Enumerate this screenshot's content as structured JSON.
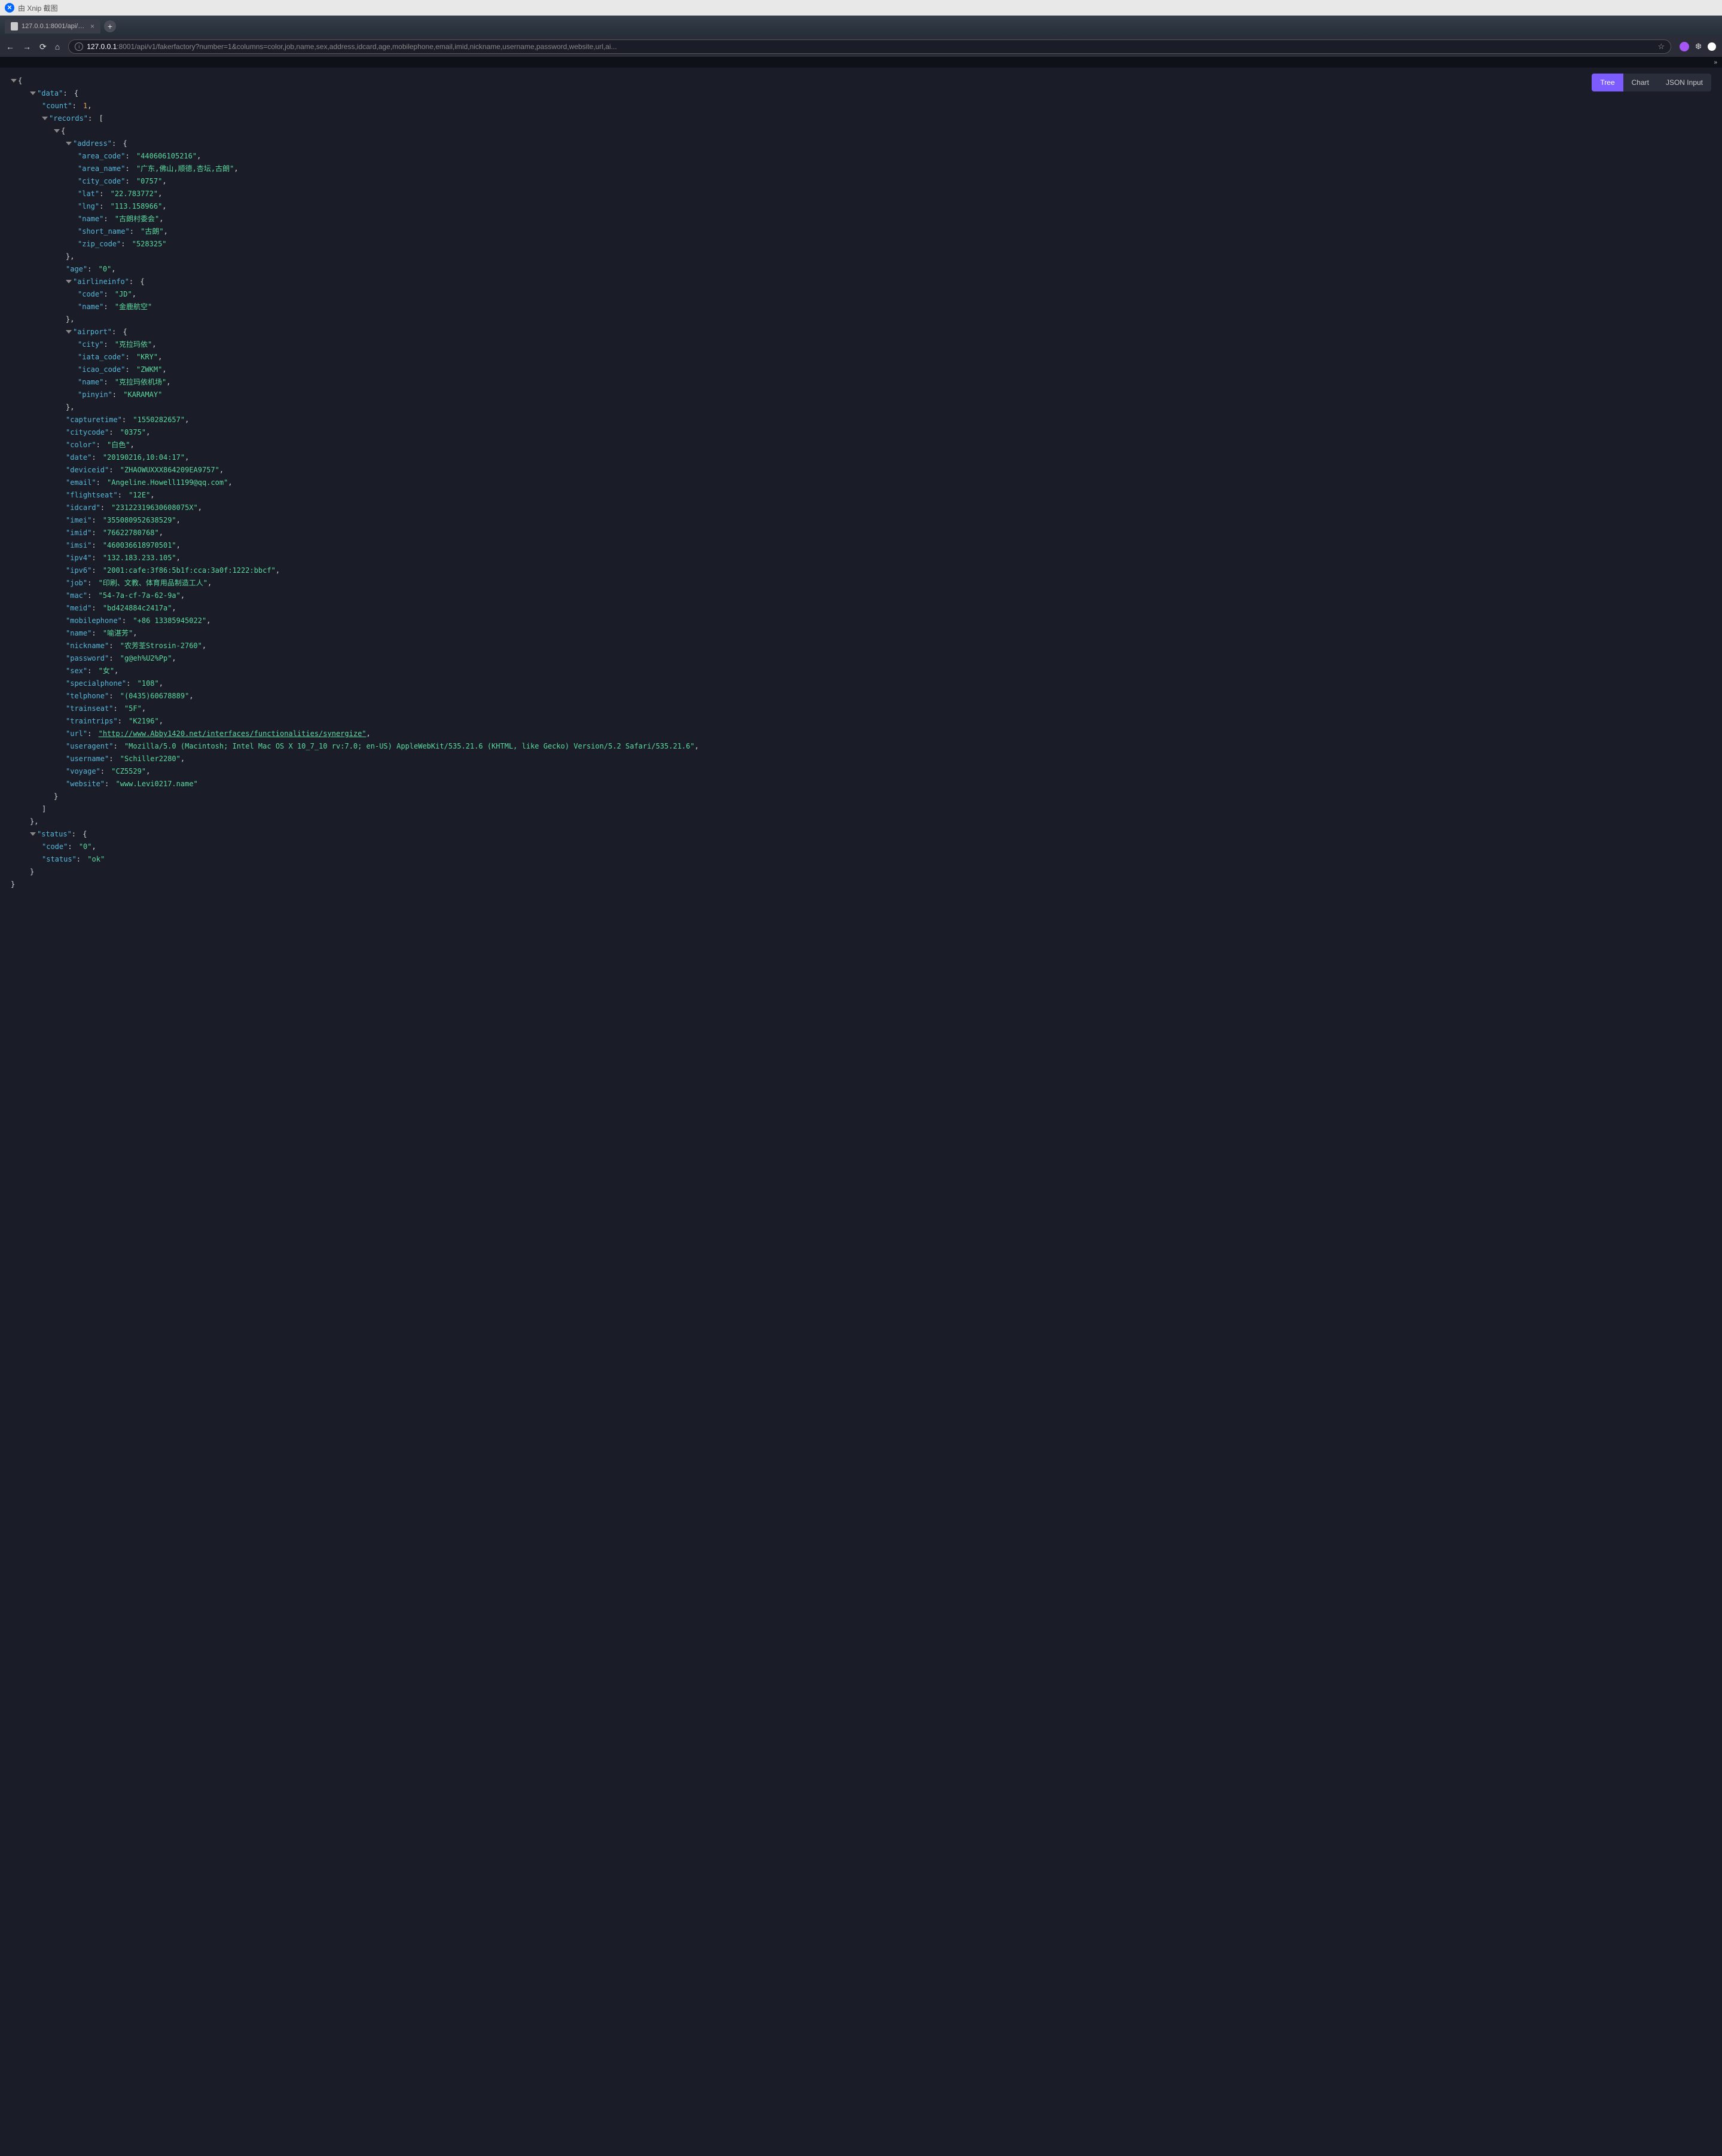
{
  "titlebar": {
    "text": "由 Xnip 截图",
    "icon_glyph": "✕"
  },
  "tab": {
    "title": "127.0.0.1:8001/api/v1/fakerfac..."
  },
  "url": {
    "host": "127.0.0.1",
    "path": ":8001/api/v1/fakerfactory?number=1&columns=color,job,name,sex,address,idcard,age,mobilephone,email,imid,nickname,username,password,website,url,ai..."
  },
  "view_tabs": {
    "tree": "Tree",
    "chart": "Chart",
    "json_input": "JSON Input"
  },
  "json": {
    "data_key": "\"data\"",
    "count_key": "\"count\"",
    "count_val": "1",
    "records_key": "\"records\"",
    "address_key": "\"address\"",
    "address": {
      "area_code_k": "\"area_code\"",
      "area_code_v": "\"440606105216\"",
      "area_name_k": "\"area_name\"",
      "area_name_v": "\"广东,佛山,顺德,杏坛,古朗\"",
      "city_code_k": "\"city_code\"",
      "city_code_v": "\"0757\"",
      "lat_k": "\"lat\"",
      "lat_v": "\"22.783772\"",
      "lng_k": "\"lng\"",
      "lng_v": "\"113.158966\"",
      "name_k": "\"name\"",
      "name_v": "\"古朗村委会\"",
      "short_name_k": "\"short_name\"",
      "short_name_v": "\"古朗\"",
      "zip_code_k": "\"zip_code\"",
      "zip_code_v": "\"528325\""
    },
    "age_k": "\"age\"",
    "age_v": "\"0\"",
    "airlineinfo_key": "\"airlineinfo\"",
    "airlineinfo": {
      "code_k": "\"code\"",
      "code_v": "\"JD\"",
      "name_k": "\"name\"",
      "name_v": "\"金鹿航空\""
    },
    "airport_key": "\"airport\"",
    "airport": {
      "city_k": "\"city\"",
      "city_v": "\"克拉玛依\"",
      "iata_code_k": "\"iata_code\"",
      "iata_code_v": "\"KRY\"",
      "icao_code_k": "\"icao_code\"",
      "icao_code_v": "\"ZWKM\"",
      "name_k": "\"name\"",
      "name_v": "\"克拉玛依机场\"",
      "pinyin_k": "\"pinyin\"",
      "pinyin_v": "\"KARAMAY\""
    },
    "capturetime_k": "\"capturetime\"",
    "capturetime_v": "\"1550282657\"",
    "citycode_k": "\"citycode\"",
    "citycode_v": "\"0375\"",
    "color_k": "\"color\"",
    "color_v": "\"白色\"",
    "date_k": "\"date\"",
    "date_v": "\"20190216,10:04:17\"",
    "deviceid_k": "\"deviceid\"",
    "deviceid_v": "\"ZHAOWUXXX864209EA9757\"",
    "email_k": "\"email\"",
    "email_v": "\"Angeline.Howell1199@qq.com\"",
    "flightseat_k": "\"flightseat\"",
    "flightseat_v": "\"12E\"",
    "idcard_k": "\"idcard\"",
    "idcard_v": "\"23122319630608075X\"",
    "imei_k": "\"imei\"",
    "imei_v": "\"355080952638529\"",
    "imid_k": "\"imid\"",
    "imid_v": "\"76622780768\"",
    "imsi_k": "\"imsi\"",
    "imsi_v": "\"460036618970501\"",
    "ipv4_k": "\"ipv4\"",
    "ipv4_v": "\"132.183.233.105\"",
    "ipv6_k": "\"ipv6\"",
    "ipv6_v": "\"2001:cafe:3f86:5b1f:cca:3a0f:1222:bbcf\"",
    "job_k": "\"job\"",
    "job_v": "\"印刷、文教、体育用品制造工人\"",
    "mac_k": "\"mac\"",
    "mac_v": "\"54-7a-cf-7a-62-9a\"",
    "meid_k": "\"meid\"",
    "meid_v": "\"bd424884c2417a\"",
    "mobilephone_k": "\"mobilephone\"",
    "mobilephone_v": "\"+86 13385945022\"",
    "name_k": "\"name\"",
    "name_v": "\"喻湛芳\"",
    "nickname_k": "\"nickname\"",
    "nickname_v": "\"农芳荃Strosin-2760\"",
    "password_k": "\"password\"",
    "password_v": "\"g@eh%U2%Pp\"",
    "sex_k": "\"sex\"",
    "sex_v": "\"女\"",
    "specialphone_k": "\"specialphone\"",
    "specialphone_v": "\"108\"",
    "telphone_k": "\"telphone\"",
    "telphone_v": "\"(0435)60678889\"",
    "trainseat_k": "\"trainseat\"",
    "trainseat_v": "\"5F\"",
    "traintrips_k": "\"traintrips\"",
    "traintrips_v": "\"K2196\"",
    "url_k": "\"url\"",
    "url_v": "\"http://www.Abby1420.net/interfaces/functionalities/synergize\"",
    "useragent_k": "\"useragent\"",
    "useragent_v": "\"Mozilla/5.0 (Macintosh; Intel Mac OS X 10_7_10 rv:7.0; en-US) AppleWebKit/535.21.6 (KHTML, like Gecko) Version/5.2 Safari/535.21.6\"",
    "username_k": "\"username\"",
    "username_v": "\"Schiller2280\"",
    "voyage_k": "\"voyage\"",
    "voyage_v": "\"CZ5529\"",
    "website_k": "\"website\"",
    "website_v": "\"www.Levi0217.name\"",
    "status_key": "\"status\"",
    "status": {
      "code_k": "\"code\"",
      "code_v": "\"0\"",
      "status_k": "\"status\"",
      "status_v": "\"ok\""
    }
  }
}
